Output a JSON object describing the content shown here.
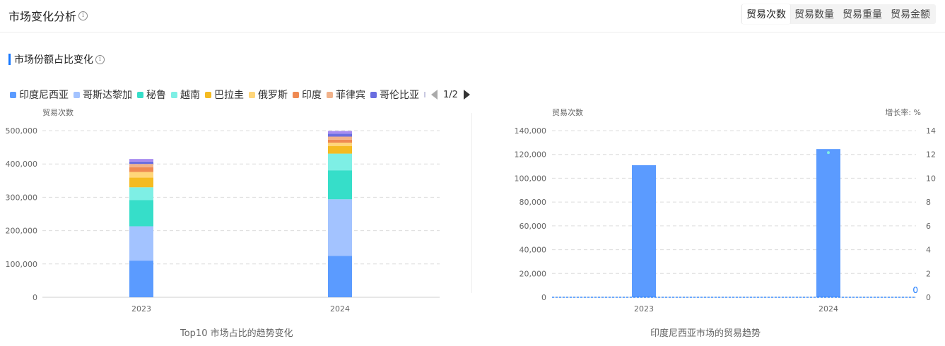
{
  "header": {
    "title": "市场变化分析",
    "info": "i",
    "tabs": [
      {
        "label": "贸易次数",
        "active": true
      },
      {
        "label": "贸易数量",
        "active": false
      },
      {
        "label": "贸易重量",
        "active": false
      },
      {
        "label": "贸易金额",
        "active": false
      }
    ]
  },
  "section": {
    "title": "市场份额占比变化",
    "info": "i"
  },
  "legend": {
    "items": [
      {
        "label": "印度尼西亚",
        "color": "#5b9bff"
      },
      {
        "label": "哥斯达黎加",
        "color": "#a3c3ff"
      },
      {
        "label": "秘鲁",
        "color": "#36dec9"
      },
      {
        "label": "越南",
        "color": "#7eefe5"
      },
      {
        "label": "巴拉圭",
        "color": "#f5bb21"
      },
      {
        "label": "俄罗斯",
        "color": "#ffd67a"
      },
      {
        "label": "印度",
        "color": "#ef8a52"
      },
      {
        "label": "菲律宾",
        "color": "#f1b28a"
      },
      {
        "label": "哥伦比亚",
        "color": "#6a6ee0"
      }
    ],
    "page": "1/2"
  },
  "chart_data": [
    {
      "type": "bar",
      "stacked": true,
      "title": "Top10 市场占比的趋势变化",
      "ylabel": "贸易次数",
      "categories": [
        "2023",
        "2024"
      ],
      "ylim": [
        0,
        500000
      ],
      "yticks": [
        "0",
        "100,000",
        "200,000",
        "300,000",
        "400,000",
        "500,000"
      ],
      "yticks_values": [
        0,
        100000,
        200000,
        300000,
        400000,
        500000
      ],
      "series": [
        {
          "name": "印度尼西亚",
          "color": "#5b9bff",
          "values": [
            110000,
            124000
          ]
        },
        {
          "name": "哥斯达黎加",
          "color": "#a3c3ff",
          "values": [
            103000,
            170000
          ]
        },
        {
          "name": "秘鲁",
          "color": "#36dec9",
          "values": [
            79000,
            87000
          ]
        },
        {
          "name": "越南",
          "color": "#7eefe5",
          "values": [
            38000,
            50000
          ]
        },
        {
          "name": "巴拉圭",
          "color": "#f5bb21",
          "values": [
            29000,
            23000
          ]
        },
        {
          "name": "俄罗斯",
          "color": "#ffd67a",
          "values": [
            17000,
            10000
          ]
        },
        {
          "name": "印度",
          "color": "#ef8a52",
          "values": [
            14000,
            9000
          ]
        },
        {
          "name": "菲律宾",
          "color": "#f1b28a",
          "values": [
            10000,
            9000
          ]
        },
        {
          "name": "哥伦比亚",
          "color": "#6a6ee0",
          "values": [
            7000,
            9000
          ]
        },
        {
          "color": "#a88cf0",
          "values": [
            8000,
            8000
          ]
        }
      ],
      "grid": true
    },
    {
      "type": "bar",
      "title": "印度尼西亚市场的贸易趋势",
      "ylabel": "贸易次数",
      "y2label": "增长率: %",
      "categories": [
        "2023",
        "2024"
      ],
      "ylim": [
        0,
        140000
      ],
      "yticks": [
        "0",
        "20,000",
        "40,000",
        "60,000",
        "80,000",
        "100,000",
        "120,000",
        "140,000"
      ],
      "yticks_values": [
        0,
        20000,
        40000,
        60000,
        80000,
        100000,
        120000,
        140000
      ],
      "y2lim": [
        0,
        14
      ],
      "y2ticks": [
        "0",
        "2",
        "4",
        "6",
        "8",
        "10",
        "12",
        "14"
      ],
      "values": [
        111000,
        124500
      ],
      "bar_color": "#5b9bff",
      "growth": {
        "values": [
          0,
          0
        ],
        "color": "#1677ff",
        "end_label": "0"
      },
      "grid": true
    }
  ]
}
